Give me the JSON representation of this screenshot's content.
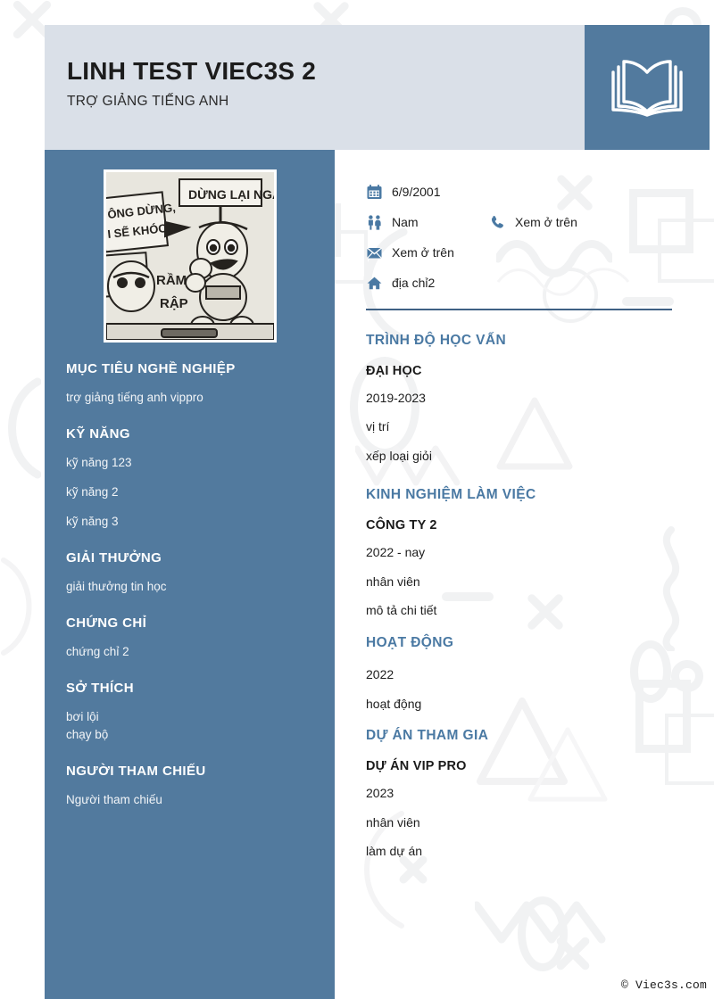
{
  "header": {
    "full_name": "LINH TEST VIEC3S 2",
    "job_title": "TRỢ GIẢNG TIẾNG ANH",
    "logo_icon": "open-book-icon",
    "bg_color": "#dae0e8",
    "logo_bg_color": "#527a9e"
  },
  "theme": {
    "accent": "#527a9e",
    "heading_blue": "#4a79a3",
    "sidebar_bg": "#527a9e",
    "page_bg": "#ffffff",
    "decor_gray": "#f1f2f3"
  },
  "sidebar": {
    "photo_alt": "comic-panel-photo",
    "sections": [
      {
        "heading": "MỤC TIÊU NGHỀ NGHIỆP",
        "items": [
          "trợ giảng tiếng anh vippro"
        ]
      },
      {
        "heading": "KỸ NĂNG",
        "items": [
          "kỹ năng 123",
          "kỹ năng 2",
          "kỹ năng 3"
        ]
      },
      {
        "heading": "GIẢI THƯỞNG",
        "items": [
          "giải thưởng tin học"
        ]
      },
      {
        "heading": "CHỨNG CHỈ",
        "items": [
          "chứng chỉ 2"
        ]
      },
      {
        "heading": "SỞ THÍCH",
        "items": [
          "bơi lội",
          "chạy bộ"
        ]
      },
      {
        "heading": "NGƯỜI THAM CHIẾU",
        "items": [
          "Người tham chiếu"
        ]
      }
    ]
  },
  "contact": {
    "birthday": {
      "icon": "calendar-icon",
      "value": "6/9/2001"
    },
    "gender": {
      "icon": "gender-icon",
      "value": "Nam"
    },
    "phone": {
      "icon": "phone-icon",
      "value": "Xem ở trên"
    },
    "email": {
      "icon": "envelope-icon",
      "value": "Xem ở trên"
    },
    "address": {
      "icon": "home-icon",
      "value": "địa chỉ2"
    }
  },
  "main": {
    "sections": [
      {
        "heading": "TRÌNH ĐỘ HỌC VẤN",
        "entries": [
          {
            "sub_heading": "ĐẠI HỌC",
            "lines": [
              "2019-2023",
              "vị trí",
              "xếp loại giỏi"
            ]
          }
        ]
      },
      {
        "heading": "KINH NGHIỆM LÀM VIỆC",
        "entries": [
          {
            "sub_heading": "CÔNG TY 2",
            "lines": [
              "2022 - nay",
              "nhân viên",
              "mô tả chi tiết"
            ]
          }
        ]
      },
      {
        "heading": "HOẠT ĐỘNG",
        "entries": [
          {
            "sub_heading": "",
            "lines": [
              "2022",
              "hoạt động"
            ]
          }
        ]
      },
      {
        "heading": "DỰ ÁN THAM GIA",
        "entries": [
          {
            "sub_heading": "DỰ ÁN VIP PRO",
            "lines": [
              "2023",
              "nhân viên",
              "làm dự án"
            ]
          }
        ]
      }
    ]
  },
  "footer": {
    "copyright": "© Viec3s.com"
  }
}
